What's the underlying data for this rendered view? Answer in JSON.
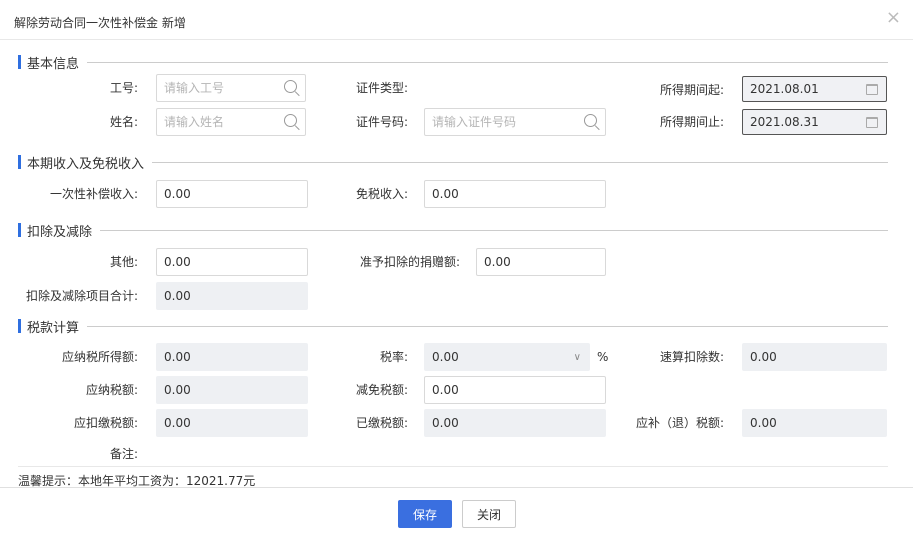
{
  "dialog": {
    "title": "解除劳动合同一次性补偿金 新增",
    "close_glyph": "×"
  },
  "sections": {
    "basic": "基本信息",
    "income": "本期收入及免税收入",
    "deduction": "扣除及减除",
    "tax": "税款计算"
  },
  "basic": {
    "emp_no_label": "工号:",
    "emp_no_placeholder": "请输入工号",
    "name_label": "姓名:",
    "name_placeholder": "请输入姓名",
    "id_type_label": "证件类型:",
    "id_no_label": "证件号码:",
    "id_no_placeholder": "请输入证件号码",
    "period_start_label": "所得期间起:",
    "period_start_value": "2021.08.01",
    "period_end_label": "所得期间止:",
    "period_end_value": "2021.08.31"
  },
  "income": {
    "comp_label": "一次性补偿收入:",
    "comp_value": "0.00",
    "exempt_label": "免税收入:",
    "exempt_value": "0.00"
  },
  "deduction": {
    "other_label": "其他:",
    "other_value": "0.00",
    "donation_label": "准予扣除的捐赠额:",
    "donation_value": "0.00",
    "total_label": "扣除及减除项目合计:",
    "total_value": "0.00"
  },
  "tax": {
    "taxable_income_label": "应纳税所得额:",
    "taxable_income_value": "0.00",
    "rate_label": "税率:",
    "rate_value": "0.00",
    "rate_unit": "%",
    "quick_deduction_label": "速算扣除数:",
    "quick_deduction_value": "0.00",
    "tax_payable_label": "应纳税额:",
    "tax_payable_value": "0.00",
    "relief_label": "减免税额:",
    "relief_value": "0.00",
    "withhold_label": "应扣缴税额:",
    "withhold_value": "0.00",
    "paid_label": "已缴税额:",
    "paid_value": "0.00",
    "refund_label": "应补（退）税额:",
    "refund_value": "0.00",
    "remark_label": "备注:"
  },
  "tips": "温馨提示：本地年平均工资为：12021.77元",
  "buttons": {
    "save": "保存",
    "close": "关闭"
  }
}
